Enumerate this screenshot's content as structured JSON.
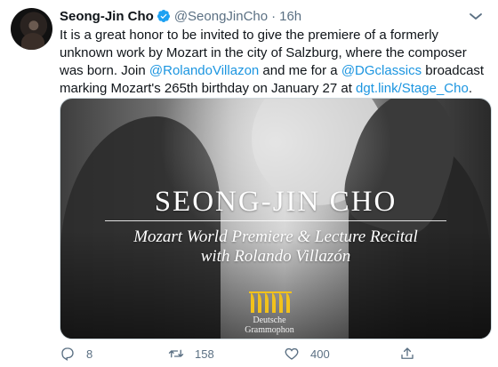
{
  "tweet": {
    "display_name": "Seong-Jin Cho",
    "handle": "@SeongJinCho",
    "separator": "·",
    "time": "16h",
    "text_parts": {
      "p1": "It is a great honor to be invited to give the premiere of a formerly unknown work by Mozart in the city of Salzburg, where the composer was born. Join ",
      "mention1": "@RolandoVillazon",
      "p2": " and me for a ",
      "mention2": "@DGclassics",
      "p3": " broadcast marking Mozart's 265th birthday on January 27 at ",
      "link": "dgt.link/Stage_Cho",
      "p4": "."
    }
  },
  "media": {
    "title": "SEONG-JIN CHO",
    "subtitle_line1": "Mozart World Premiere & Lecture Recital",
    "subtitle_line2": "with Rolando Villazón",
    "logo_text_line1": "Deutsche",
    "logo_text_line2": "Grammophon"
  },
  "actions": {
    "reply_count": "8",
    "retweet_count": "158",
    "like_count": "400"
  },
  "colors": {
    "link": "#1b95e0",
    "secondary": "#5b7083",
    "verified": "#1da1f2",
    "logo_yellow": "#f2c21b"
  },
  "icons": [
    "verified-badge-icon",
    "more-options-icon",
    "reply-icon",
    "retweet-icon",
    "like-icon",
    "share-icon"
  ]
}
